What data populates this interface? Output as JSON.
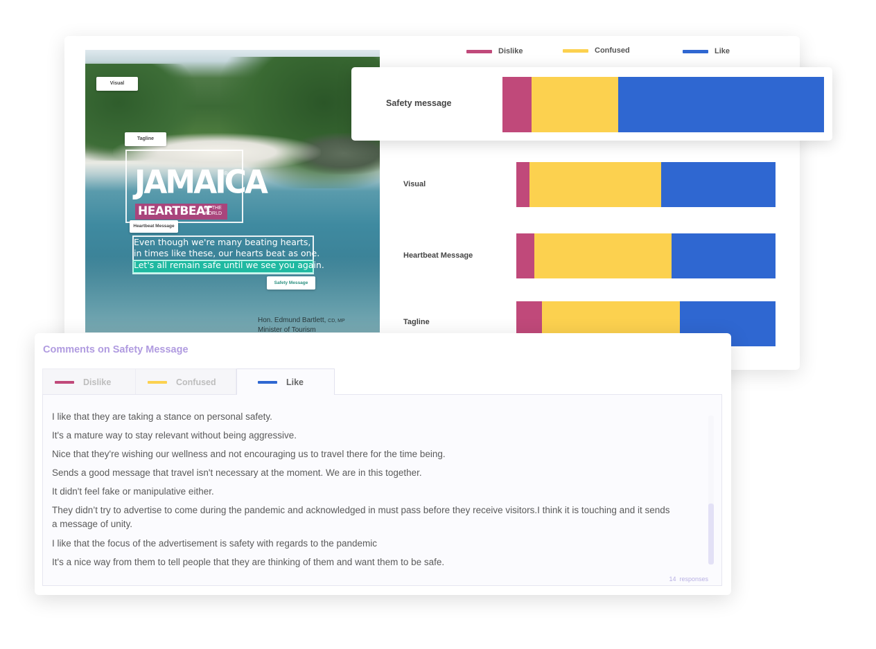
{
  "legend": [
    {
      "label": "Dislike",
      "color": "#c0497a"
    },
    {
      "label": "Confused",
      "color": "#fcd14f"
    },
    {
      "label": "Like",
      "color": "#2f67d1"
    }
  ],
  "ad_image": {
    "logo_word": "JAMAICA",
    "logo_registered": "®",
    "heartbeat_word": "HEARTBEAT",
    "heartbeat_sub": "OF THE WORLD",
    "message_lines": [
      "Even though we're many beating hearts,",
      "in times like these, our hearts beat as one.",
      "Let's all remain safe until we see you again."
    ],
    "credit_name": "Hon. Edmund Bartlett,",
    "credit_suffix": "CD, MP",
    "credit_role": "Minister of Tourism",
    "region_tags": {
      "visual": "Visual",
      "tagline": "Tagline",
      "heartbeat_message": "Heartbeat Message",
      "safety_message": "Safety Message"
    }
  },
  "chart_data": {
    "type": "bar",
    "orientation": "horizontal",
    "stacked": true,
    "normalized": true,
    "categories": [
      "Safety message",
      "Visual",
      "Heartbeat Message",
      "Tagline"
    ],
    "series": [
      {
        "name": "Dislike",
        "color": "#c0497a",
        "values": [
          9,
          5,
          7,
          10
        ]
      },
      {
        "name": "Confused",
        "color": "#fcd14f",
        "values": [
          27,
          51,
          53,
          53
        ]
      },
      {
        "name": "Like",
        "color": "#2f67d1",
        "values": [
          64,
          44,
          40,
          37
        ]
      }
    ],
    "legend_position": "top"
  },
  "comments": {
    "title": "Comments on Safety Message",
    "tabs": [
      {
        "label": "Dislike",
        "color": "#c0497a"
      },
      {
        "label": "Confused",
        "color": "#fcd14f"
      },
      {
        "label": "Like",
        "color": "#2f67d1"
      }
    ],
    "active_tab": "Like",
    "items": [
      "I like that they are taking a stance on personal safety.",
      "It's a mature way to stay relevant without being aggressive.",
      "Nice that they're wishing our wellness and not encouraging us to travel there for the time being.",
      "Sends a good message that travel isn't necessary at the moment. We are in this together.",
      "It didn't feel fake or manipulative either.",
      "They didn’t try to advertise to come during the pandemic and acknowledged in must pass before they receive visitors.I think it is touching and it sends a message of unity.",
      "I like that the focus of the advertisement is safety with regards to the pandemic",
      "It's a nice way from them to tell people that they are thinking of them and want them to be safe."
    ],
    "responses_count": "14",
    "responses_label": "responses"
  }
}
